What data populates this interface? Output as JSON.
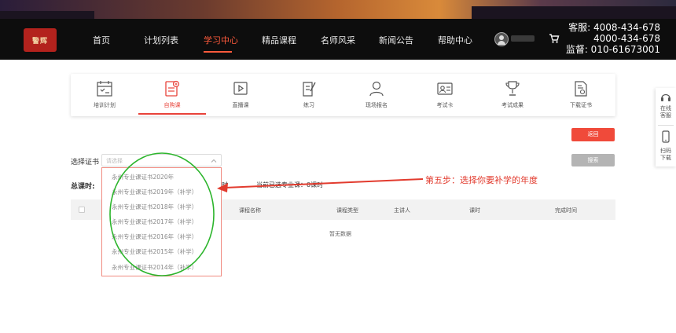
{
  "header": {
    "logo_text": "警辉",
    "nav": [
      {
        "label": "首页"
      },
      {
        "label": "计划列表"
      },
      {
        "label": "学习中心"
      },
      {
        "label": "精品课程"
      },
      {
        "label": "名师风采"
      },
      {
        "label": "新闻公告"
      },
      {
        "label": "帮助中心"
      }
    ],
    "active_nav": "学习中心",
    "contact": {
      "line1": "客服: 4008-434-678",
      "line2": "4000-434-678",
      "line3": "监督: 010-61673001"
    }
  },
  "tabs": [
    {
      "label": "培训计划",
      "icon": "calendar-icon"
    },
    {
      "label": "自购课",
      "icon": "purchase-course-icon",
      "active": true
    },
    {
      "label": "直播课",
      "icon": "live-course-icon"
    },
    {
      "label": "练习",
      "icon": "practice-icon"
    },
    {
      "label": "现场报名",
      "icon": "user-register-icon"
    },
    {
      "label": "考试卡",
      "icon": "exam-card-icon"
    },
    {
      "label": "考试成果",
      "icon": "trophy-icon"
    },
    {
      "label": "下载证书",
      "icon": "certificate-icon"
    }
  ],
  "float_panel": {
    "service_line1": "在线",
    "service_line2": "客服",
    "scan_line1": "扫码",
    "scan_line2": "下载"
  },
  "buttons": {
    "back": "返回",
    "search": "搜索"
  },
  "filters": {
    "cert_label": "选择证书",
    "cert_placeholder": "请选择",
    "options": [
      "永州专业课证书2020年",
      "永州专业课证书2019年（补学）",
      "永州专业课证书2018年（补学）",
      "永州专业课证书2017年（补学）",
      "永州专业课证书2016年（补学）",
      "永州专业课证书2015年（补学）",
      "永州专业课证书2014年（补学）"
    ],
    "total_label": "总课时:",
    "partial_char": "时",
    "selected_info": "当前已选专业课：0课时"
  },
  "table": {
    "columns": [
      "课程名称",
      "课程类型",
      "主讲人",
      "课时",
      "完成时间"
    ],
    "empty_text": "暂无数据"
  },
  "annotation": {
    "text": "第五步：选择你要补学的年度",
    "color": "#e23b2e"
  },
  "colors": {
    "accent": "#e8433a",
    "header_bg": "#0d0d0d",
    "circle": "#2db52d"
  }
}
